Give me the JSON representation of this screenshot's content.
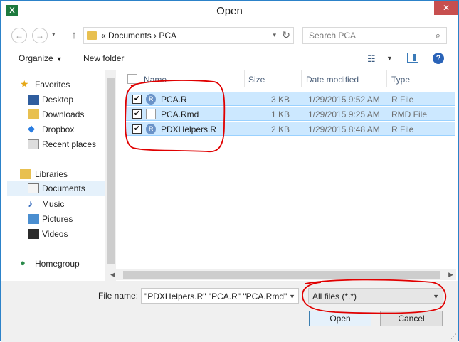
{
  "window": {
    "title": "Open",
    "app_icon": "X",
    "close_symbol": "✕"
  },
  "nav": {
    "back_icon": "←",
    "forward_icon": "→",
    "recent_icon": "▾",
    "up_icon": "↑"
  },
  "address": {
    "prefix": "«",
    "path": "Documents  ›  PCA",
    "refresh_icon": "↻"
  },
  "search": {
    "placeholder": "Search PCA",
    "icon": "⌕"
  },
  "toolbar": {
    "organize": "Organize",
    "new_folder": "New folder",
    "help": "?"
  },
  "sidebar": {
    "favorites": "Favorites",
    "favorites_items": [
      "Desktop",
      "Downloads",
      "Dropbox",
      "Recent places"
    ],
    "libraries": "Libraries",
    "libraries_items": [
      "Documents",
      "Music",
      "Pictures",
      "Videos"
    ],
    "homegroup": "Homegroup"
  },
  "columns": {
    "name": "Name",
    "size": "Size",
    "date": "Date modified",
    "type": "Type"
  },
  "files": [
    {
      "name": "PCA.R",
      "size": "3 KB",
      "date": "1/29/2015 9:52 AM",
      "type": "R File",
      "icon": "r-file-icon",
      "checked": true
    },
    {
      "name": "PCA.Rmd",
      "size": "1 KB",
      "date": "1/29/2015 9:25 AM",
      "type": "RMD File",
      "icon": "document-icon",
      "checked": true
    },
    {
      "name": "PDXHelpers.R",
      "size": "2 KB",
      "date": "1/29/2015 8:48 AM",
      "type": "R File",
      "icon": "r-file-icon",
      "checked": true
    }
  ],
  "footer": {
    "file_name_label": "File name:",
    "file_name_value": "\"PDXHelpers.R\" \"PCA.R\" \"PCA.Rmd\"",
    "filter_value": "All files (*.*)",
    "open_label": "Open",
    "cancel_label": "Cancel"
  },
  "colors": {
    "selection": "#cce8ff",
    "accent": "#2c82c9",
    "annotation": "#e00000"
  }
}
